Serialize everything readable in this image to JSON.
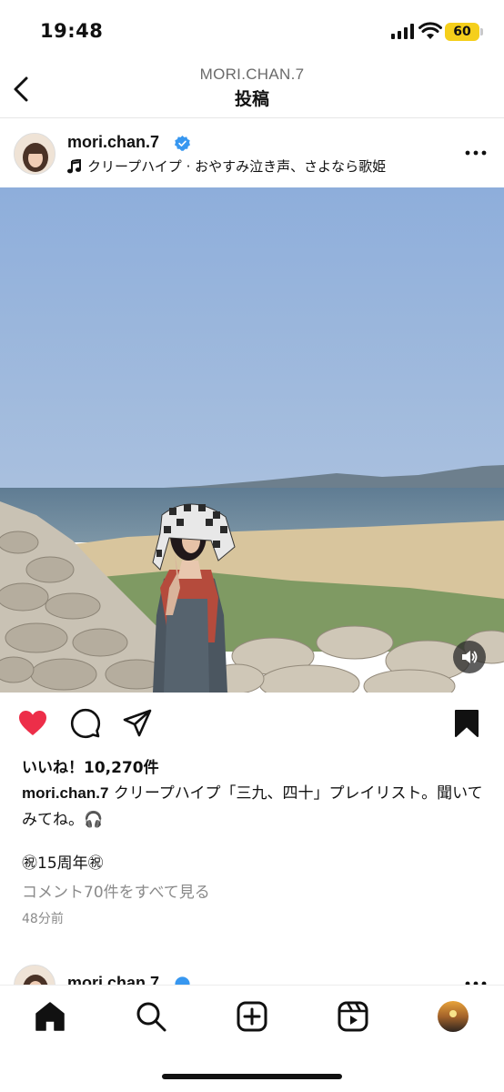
{
  "status_bar": {
    "time": "19:48",
    "battery": "60",
    "battery_color": "#f5cf1b"
  },
  "header": {
    "account": "MORI.CHAN.7",
    "title": "投稿"
  },
  "post": {
    "username": "mori.chan.7",
    "verified": true,
    "music": "クリープハイプ · おやすみ泣き声、さよなら歌姫",
    "liked": true,
    "saved": true,
    "likes": "いいね！10,270件",
    "caption_user": "mori.chan.7",
    "caption_text": " クリープハイプ「三九、四十」プレイリスト。聞いてみてね。🎧",
    "anniversary": "㊗15周年㊗",
    "comments_link": "コメント70件をすべて見る",
    "time_ago": "48分前"
  },
  "next_post": {
    "username": "mori.chan.7"
  },
  "colors": {
    "like_red": "#ed2e49",
    "verified_blue": "#3797f0"
  },
  "tabs": [
    "home-icon",
    "search-icon",
    "create-icon",
    "reels-icon",
    "profile-avatar"
  ]
}
